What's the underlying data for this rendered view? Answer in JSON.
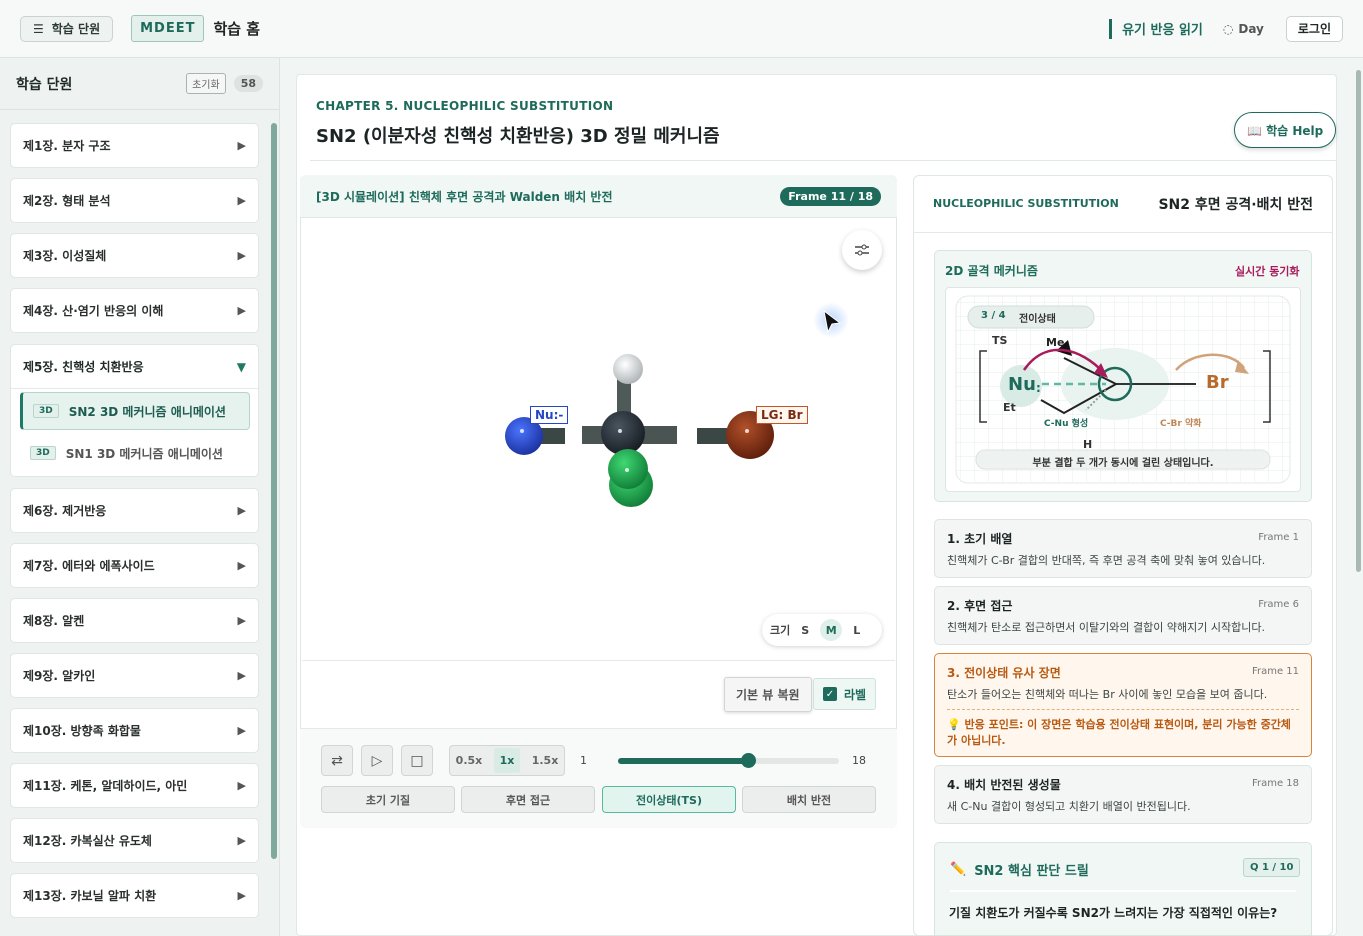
{
  "topbar": {
    "units_button": "학습 단원",
    "brand": "MDEET",
    "home": "학습 홈",
    "read_link": "유기 반응 읽기",
    "theme": "Day",
    "login": "로그인"
  },
  "sidebar": {
    "title": "학습 단원",
    "reset": "초기화",
    "count": "58",
    "chapters_before": [
      "제1장. 분자 구조",
      "제2장. 형태 분석",
      "제3장. 이성질체",
      "제4장. 산·염기 반응의 이해"
    ],
    "open_chapter": "제5장. 친핵성 치환반응",
    "sub_items": [
      {
        "tag": "3D",
        "label": "SN2 3D 메커니즘 애니메이션"
      },
      {
        "tag": "3D",
        "label": "SN1 3D 메커니즘 애니메이션"
      }
    ],
    "chapters_after": [
      "제6장. 제거반응",
      "제7장. 에터와 에폭사이드",
      "제8장. 알켄",
      "제9장. 알카인",
      "제10장. 방향족 화합물",
      "제11장. 케톤, 알데하이드, 아민",
      "제12장. 카복실산 유도체",
      "제13장. 카보닐 알파 치환"
    ]
  },
  "page": {
    "kicker": "CHAPTER 5. NUCLEOPHILIC SUBSTITUTION",
    "title": "SN2 (이분자성 친핵성 치환반응) 3D 정밀 메커니즘",
    "help": "📖 학습 Help"
  },
  "simulation": {
    "title": "[3D 시뮬레이션] 친핵체 후면 공격과 Walden 배치 반전",
    "frame_badge": "Frame 11 / 18",
    "nu_label": "Nu:-",
    "lg_label": "LG: Br",
    "size_label": "크기",
    "sizes": [
      "S",
      "M",
      "L"
    ],
    "reset_view": "기본 뷰 복원",
    "label_toggle": "라벨",
    "speeds": [
      "0.5x",
      "1x",
      "1.5x"
    ],
    "frame_min": "1",
    "frame_max": "18",
    "frame_progress": 0.588,
    "steps": [
      "초기 기질",
      "후면 접근",
      "전이상태(TS)",
      "배치 반전"
    ]
  },
  "panel": {
    "kicker": "NUCLEOPHILIC SUBSTITUTION",
    "title": "SN2 후면 공격·배치 반전",
    "mech_label": "2D 골격 메커니즘",
    "sync": "실시간 동기화",
    "mech": {
      "progress": "3 / 4",
      "state": "전이상태",
      "ts": "TS",
      "me": "Me",
      "nu": "Nu",
      "et": "Et",
      "br": "Br",
      "h": "H",
      "cnu": "C-Nu 형성",
      "cbr": "C-Br 약화",
      "caption": "부분 결합 두 개가 동시에 걸린 상태입니다."
    },
    "steps": [
      {
        "title": "1. 초기 배열",
        "frame": "Frame 1",
        "desc": "친핵체가 C-Br 결합의 반대쪽, 즉 후면 공격 축에 맞춰 놓여 있습니다."
      },
      {
        "title": "2. 후면 접근",
        "frame": "Frame 6",
        "desc": "친핵체가 탄소로 접근하면서 이탈기와의 결합이 약해지기 시작합니다."
      },
      {
        "title": "3. 전이상태 유사 장면",
        "frame": "Frame 11",
        "desc": "탄소가 들어오는 친핵체와 떠나는 Br 사이에 놓인 모습을 보여 줍니다.",
        "point": "💡 반응 포인트: 이 장면은 학습용 전이상태 표현이며, 분리 가능한 중간체가 아닙니다."
      },
      {
        "title": "4. 배치 반전된 생성물",
        "frame": "Frame 18",
        "desc": "새 C-Nu 결합이 형성되고 치환기 배열이 반전됩니다."
      }
    ],
    "drill_title": "SN2 핵심 판단 드릴",
    "drill_badge": "Q 1 / 10",
    "drill_question": "기질 치환도가 커질수록 SN2가 느려지는 가장 직접적인 이유는?"
  },
  "colors": {
    "accent": "#1e6b5b",
    "nucleophile": "#2446c8",
    "leaving_group": "#7a2a12",
    "carbon": "#1c2228",
    "chlorine": "#1ea04a"
  }
}
